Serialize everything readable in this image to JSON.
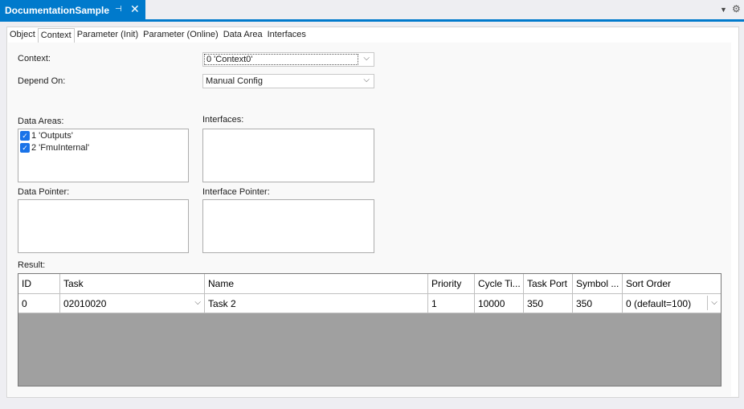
{
  "document_tab": {
    "title": "DocumentationSample",
    "pin_icon": "pin-icon",
    "close_glyph": "✕",
    "pin_glyph": "⊣"
  },
  "strip": {
    "menu_glyph": "▼",
    "gear_glyph": "⚙"
  },
  "property_tabs": [
    {
      "label": "Object"
    },
    {
      "label": "Context",
      "active": true
    },
    {
      "label": "Parameter (Init)"
    },
    {
      "label": "Parameter (Online)"
    },
    {
      "label": "Data Area"
    },
    {
      "label": "Interfaces"
    }
  ],
  "context": {
    "label": "Context:",
    "value": "0 'Context0'"
  },
  "depend_on": {
    "label": "Depend On:",
    "value": "Manual Config"
  },
  "data_areas": {
    "label": "Data Areas:",
    "items": [
      {
        "label": "1 'Outputs'",
        "checked": true
      },
      {
        "label": "2 'FmuInternal'",
        "checked": true
      }
    ]
  },
  "interfaces": {
    "label": "Interfaces:"
  },
  "data_pointer": {
    "label": "Data Pointer:"
  },
  "interface_pointer": {
    "label": "Interface Pointer:"
  },
  "result": {
    "label": "Result:",
    "columns": [
      "ID",
      "Task",
      "Name",
      "Priority",
      "Cycle Ti...",
      "Task Port",
      "Symbol ...",
      "Sort Order"
    ],
    "rows": [
      [
        "0",
        "02010020",
        "Task 2",
        "1",
        "10000",
        "350",
        "350",
        "0 (default=100)"
      ]
    ]
  },
  "glyphs": {
    "dropdown": "⌵",
    "check": "✓"
  }
}
